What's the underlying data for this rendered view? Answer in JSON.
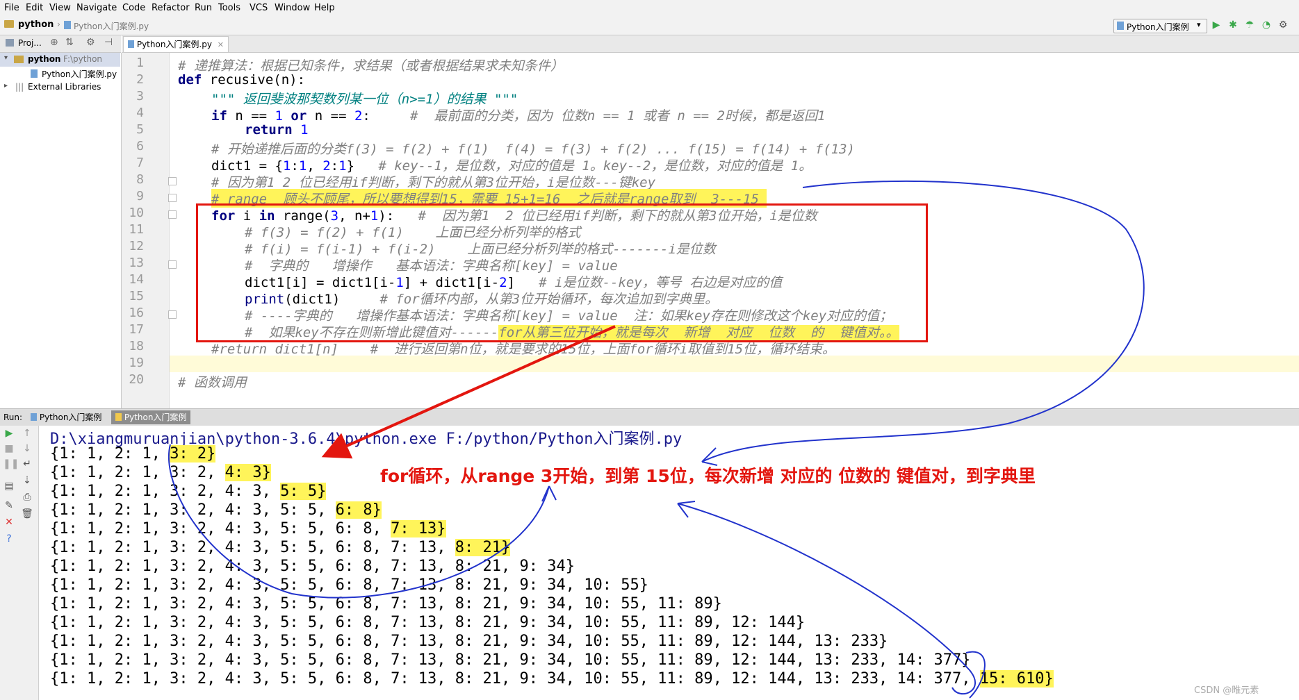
{
  "menu": [
    "File",
    "Edit",
    "View",
    "Navigate",
    "Code",
    "Refactor",
    "Run",
    "Tools",
    "VCS",
    "Window",
    "Help"
  ],
  "breadcrumb": {
    "project": "python",
    "file": "Python入门案例.py"
  },
  "run_config": "Python入门案例",
  "project_panel": {
    "header": "Proj...",
    "root": "python",
    "root_path": "F:\\python",
    "file": "Python入门案例.py",
    "external": "External Libraries"
  },
  "editor_tab": "Python入门案例.py",
  "line_numbers": [
    "1",
    "2",
    "3",
    "4",
    "5",
    "6",
    "7",
    "8",
    "9",
    "10",
    "11",
    "12",
    "13",
    "14",
    "15",
    "16",
    "17",
    "18",
    "19",
    "20"
  ],
  "code": {
    "l1": "# 递推算法：根据已知条件，求结果（或者根据结果求未知条件）",
    "l2_kw": "def",
    "l2_rest": " recusive(n):",
    "l3": "\"\"\" 返回斐波那契数列某一位（n>=1）的结果 \"\"\"",
    "l4_a": "if",
    "l4_b": " n == ",
    "l4_c": "1",
    "l4_d": " or",
    "l4_e": " n == ",
    "l4_f": "2",
    "l4_g": ":     ",
    "l4_cm": "#  最前面的分类，因为 位数n == 1 或者 n == 2时候，都是返回1",
    "l5_kw": "return",
    "l5_num": " 1",
    "l6": "# 开始递推后面的分类f(3) = f(2) + f(1)  f(4) = f(3) + f(2) ... f(15) = f(14) + f(13)",
    "l7_a": "dict1 = {",
    "l7_b": "1",
    "l7_c": ":",
    "l7_d": "1",
    "l7_e": ", ",
    "l7_f": "2",
    "l7_g": ":",
    "l7_h": "1",
    "l7_i": "}   ",
    "l7_cm": "# key--1，是位数，对应的值是 1。key--2，是位数，对应的值是 1。",
    "l8": "# 因为第1 2 位已经用if判断，剩下的就从第3位开始，i是位数---键key",
    "l9": "# range  顾头不顾尾，所以要想得到15，需要 15+1=16  之后就是range取到  3---15 ",
    "l10_kw": "for",
    "l10_b": " i ",
    "l10_c": "in",
    "l10_d": " range(",
    "l10_e": "3",
    "l10_f": ", n+",
    "l10_g": "1",
    "l10_h": "):   ",
    "l10_cm": "#  因为第1  2 位已经用if判断，剩下的就从第3位开始，i是位数",
    "l11": "# f(3) = f(2) + f(1)    上面已经分析列举的格式",
    "l12": "# f(i) = f(i-1) + f(i-2)    上面已经分析列举的格式-------i是位数",
    "l13": "#  字典的   增操作   基本语法：字典名称[key] = value",
    "l14_a": "dict1[i] = dict1[i-",
    "l14_b": "1",
    "l14_c": "] + dict1[i-",
    "l14_d": "2",
    "l14_e": "]   ",
    "l14_cm": "# i是位数--key，等号 右边是对应的值",
    "l15_a": "print",
    "l15_b": "(dict1)     ",
    "l15_cm": "# for循环内部，从第3位开始循环，每次追加到字典里。",
    "l16": "# ----字典的   增操作基本语法：字典名称[key] = value  注：如果key存在则修改这个key对应的值；",
    "l17_a": "#  如果key不存在则新增此键值对------",
    "l17_b": "for从第三位开始，就是每次  新增  对应  位数  的  键值对。。",
    "l18": "#return dict1[n]    #  进行返回第n位，就是要求的15位，上面for循环i取值到15位，循环结束。",
    "l19": "",
    "l20": "# 函数调用"
  },
  "run_panel": {
    "label": "Run:",
    "tab1": "Python入门案例",
    "tab2": "Python入门案例"
  },
  "console": {
    "cmd": "D:\\xiangmuruanjian\\python-3.6.4\\python.exe F:/python/Python入门案例.py",
    "o1": {
      "pre": "{1: 1, 2: 1, ",
      "hl": "3: 2}",
      "post": ""
    },
    "o2": {
      "pre": "{1: 1, 2: 1, 3: 2, ",
      "hl": "4: 3}",
      "post": ""
    },
    "o3": {
      "pre": "{1: 1, 2: 1, 3: 2, 4: 3, ",
      "hl": "5: 5}",
      "post": ""
    },
    "o4": {
      "pre": "{1: 1, 2: 1, 3: 2, 4: 3, 5: 5, ",
      "hl": "6: 8}",
      "post": ""
    },
    "o5": {
      "pre": "{1: 1, 2: 1, 3: 2, 4: 3, 5: 5, 6: 8, ",
      "hl": "7: 13}",
      "post": ""
    },
    "o6": {
      "pre": "{1: 1, 2: 1, 3: 2, 4: 3, 5: 5, 6: 8, 7: 13, ",
      "hl": "8: 21}",
      "post": ""
    },
    "o7": "{1: 1, 2: 1, 3: 2, 4: 3, 5: 5, 6: 8, 7: 13, 8: 21, 9: 34}",
    "o8": "{1: 1, 2: 1, 3: 2, 4: 3, 5: 5, 6: 8, 7: 13, 8: 21, 9: 34, 10: 55}",
    "o9": "{1: 1, 2: 1, 3: 2, 4: 3, 5: 5, 6: 8, 7: 13, 8: 21, 9: 34, 10: 55, 11: 89}",
    "o10": "{1: 1, 2: 1, 3: 2, 4: 3, 5: 5, 6: 8, 7: 13, 8: 21, 9: 34, 10: 55, 11: 89, 12: 144}",
    "o11": "{1: 1, 2: 1, 3: 2, 4: 3, 5: 5, 6: 8, 7: 13, 8: 21, 9: 34, 10: 55, 11: 89, 12: 144, 13: 233}",
    "o12": "{1: 1, 2: 1, 3: 2, 4: 3, 5: 5, 6: 8, 7: 13, 8: 21, 9: 34, 10: 55, 11: 89, 12: 144, 13: 233, 14: 377}",
    "o13": {
      "pre": "{1: 1, 2: 1, 3: 2, 4: 3, 5: 5, 6: 8, 7: 13, 8: 21, 9: 34, 10: 55, 11: 89, 12: 144, 13: 233, 14: 377, ",
      "hl": "15: 610}",
      "post": ""
    }
  },
  "annotation": "for循环，从range 3开始，到第 15位，每次新增  对应的  位数的  键值对，到字典里",
  "watermark": "CSDN @睢元素",
  "colors": {
    "highlight": "#fff45a",
    "annotation_red": "#e3160f",
    "box_red": "#e3160f",
    "ink_blue": "#2233cc"
  }
}
